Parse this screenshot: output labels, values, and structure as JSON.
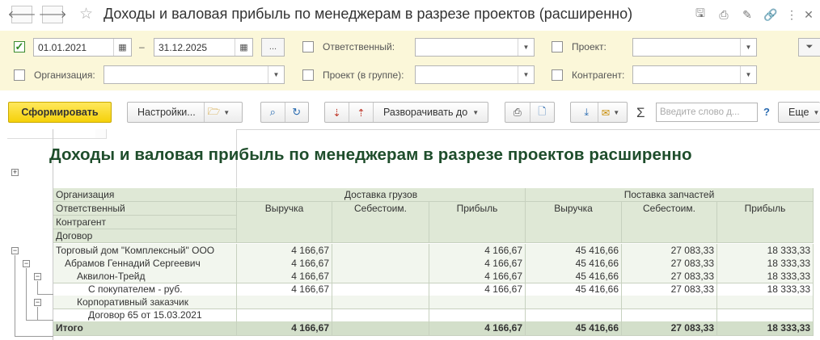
{
  "window": {
    "title": "Доходы и валовая прибыль по менеджерам в разрезе проектов (расширенно)"
  },
  "filters": {
    "period": {
      "checked": true,
      "from": "01.01.2021",
      "dash": "–",
      "to": "31.12.2025",
      "more_label": "..."
    },
    "organization": {
      "label": "Организация:",
      "value": ""
    },
    "responsible": {
      "label": "Ответственный:",
      "value": ""
    },
    "project_group": {
      "label": "Проект (в группе):",
      "value": ""
    },
    "project": {
      "label": "Проект:",
      "value": ""
    },
    "counterparty": {
      "label": "Контрагент:",
      "value": ""
    }
  },
  "toolbar": {
    "generate_label": "Сформировать",
    "settings_label": "Настройки...",
    "expand_label": "Разворачивать до",
    "sum_symbol": "Σ",
    "search_placeholder": "Введите слово д...",
    "help_label": "?",
    "more_label": "Еще"
  },
  "report": {
    "title": "Доходы и валовая прибыль по менеджерам в разрезе проектов расширенно",
    "row_headers": [
      "Организация",
      "Ответственный",
      "Контрагент",
      "Договор"
    ],
    "groups": [
      "Доставка грузов",
      "Поставка запчастей"
    ],
    "columns": [
      "Выручка",
      "Себестоим.",
      "Прибыль",
      "Выручка",
      "Себестоим.",
      "Прибыль"
    ],
    "rows": [
      {
        "label": "Торговый дом \"Комплексный\" ООО",
        "values": [
          "4 166,67",
          "",
          "4 166,67",
          "45 416,66",
          "27 083,33",
          "18 333,33"
        ]
      },
      {
        "label": "Абрамов Геннадий Сергеевич",
        "values": [
          "4 166,67",
          "",
          "4 166,67",
          "45 416,66",
          "27 083,33",
          "18 333,33"
        ]
      },
      {
        "label": "Аквилон-Трейд",
        "values": [
          "4 166,67",
          "",
          "4 166,67",
          "45 416,66",
          "27 083,33",
          "18 333,33"
        ]
      },
      {
        "label": "С покупателем - руб.",
        "values": [
          "4 166,67",
          "",
          "4 166,67",
          "45 416,66",
          "27 083,33",
          "18 333,33"
        ]
      },
      {
        "label": "Корпоративный заказчик",
        "values": [
          "",
          "",
          "",
          "",
          "",
          ""
        ]
      },
      {
        "label": "Договор 65 от 15.03.2021",
        "values": [
          "",
          "",
          "",
          "",
          "",
          ""
        ]
      }
    ],
    "total": {
      "label": "Итого",
      "values": [
        "4 166,67",
        "",
        "4 166,67",
        "45 416,66",
        "27 083,33",
        "18 333,33"
      ]
    }
  },
  "colors": {
    "accent": "#f5d10a",
    "filter_bg": "#fbf7d9",
    "header_bg": "#dfe8d6",
    "title": "#1e4d2b"
  }
}
